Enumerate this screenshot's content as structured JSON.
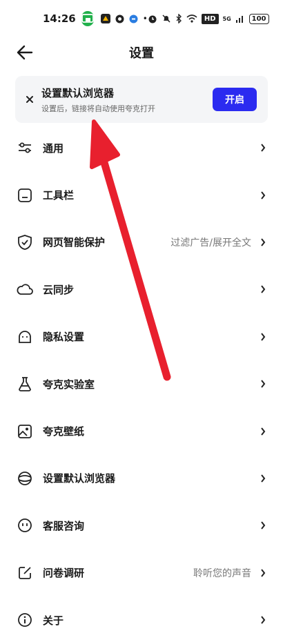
{
  "status_bar": {
    "time": "14:26",
    "signal_label": "5G",
    "battery": "100",
    "hd_label": "HD"
  },
  "header": {
    "title": "设置"
  },
  "banner": {
    "title": "设置默认浏览器",
    "subtitle": "设置后，链接将自动使用夸克打开",
    "button_label": "开启"
  },
  "items": [
    {
      "label": "通用",
      "value": "",
      "icon": "sliders-icon"
    },
    {
      "label": "工具栏",
      "value": "",
      "icon": "toolbar-icon"
    },
    {
      "label": "网页智能保护",
      "value": "过滤广告/展开全文",
      "icon": "shield-check-icon"
    },
    {
      "label": "云同步",
      "value": "",
      "icon": "cloud-icon"
    },
    {
      "label": "隐私设置",
      "value": "",
      "icon": "privacy-face-icon"
    },
    {
      "label": "夸克实验室",
      "value": "",
      "icon": "flask-icon"
    },
    {
      "label": "夸克壁纸",
      "value": "",
      "icon": "image-icon"
    },
    {
      "label": "设置默认浏览器",
      "value": "",
      "icon": "browser-icon"
    },
    {
      "label": "客服咨询",
      "value": "",
      "icon": "service-icon"
    },
    {
      "label": "问卷调研",
      "value": "聆听您的声音",
      "icon": "edit-icon"
    },
    {
      "label": "关于",
      "value": "",
      "icon": "info-icon"
    }
  ],
  "colors": {
    "accent": "#2b2bf0",
    "annotation_arrow": "#e8202e",
    "cast_pill": "#21b04b"
  }
}
